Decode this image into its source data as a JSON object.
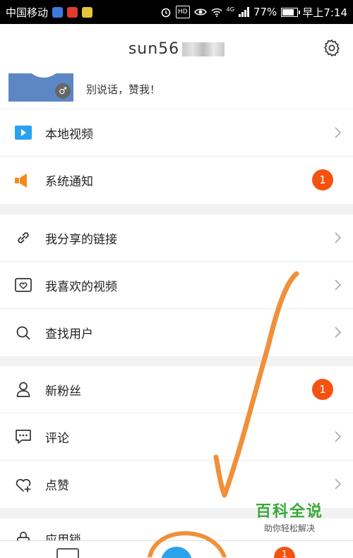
{
  "status_bar": {
    "carrier": "中国移动",
    "battery": "77%",
    "network": "4G",
    "time": "早上7:14",
    "hd": "HD",
    "app_icon_colors": [
      "#3b7be0",
      "#e23b2e",
      "#e8c53a"
    ]
  },
  "header": {
    "username": "sun56",
    "settings_icon": "gear-icon"
  },
  "profile": {
    "signature": "别说话，赞我！",
    "gender_icon": "male-icon",
    "gender_symbol": "♂"
  },
  "menu": {
    "group1": [
      {
        "label": "本地视频",
        "icon": "play-icon",
        "accessory": "chevron"
      },
      {
        "label": "系统通知",
        "icon": "speaker-icon",
        "badge": "1"
      }
    ],
    "group2": [
      {
        "label": "我分享的链接",
        "icon": "link-icon",
        "accessory": "chevron"
      },
      {
        "label": "我喜欢的视频",
        "icon": "heart-video-icon",
        "accessory": "chevron"
      },
      {
        "label": "查找用户",
        "icon": "search-icon",
        "accessory": "chevron"
      }
    ],
    "group3": [
      {
        "label": "新粉丝",
        "icon": "user-icon",
        "badge": "1"
      },
      {
        "label": "评论",
        "icon": "comment-icon",
        "accessory": "chevron"
      },
      {
        "label": "点赞",
        "icon": "heart-plus-icon",
        "accessory": "chevron"
      }
    ],
    "group4": [
      {
        "label": "应用锁",
        "icon": "lock-icon"
      }
    ]
  },
  "bottom_nav": {
    "badge": "1"
  },
  "watermark": {
    "title": "百科全说",
    "subtitle": "助你轻松解决"
  },
  "colors": {
    "accent_blue": "#2aa3ef",
    "badge_orange": "#f6520f",
    "speaker_orange": "#f58a1f",
    "annotation_orange": "#f0903c"
  }
}
